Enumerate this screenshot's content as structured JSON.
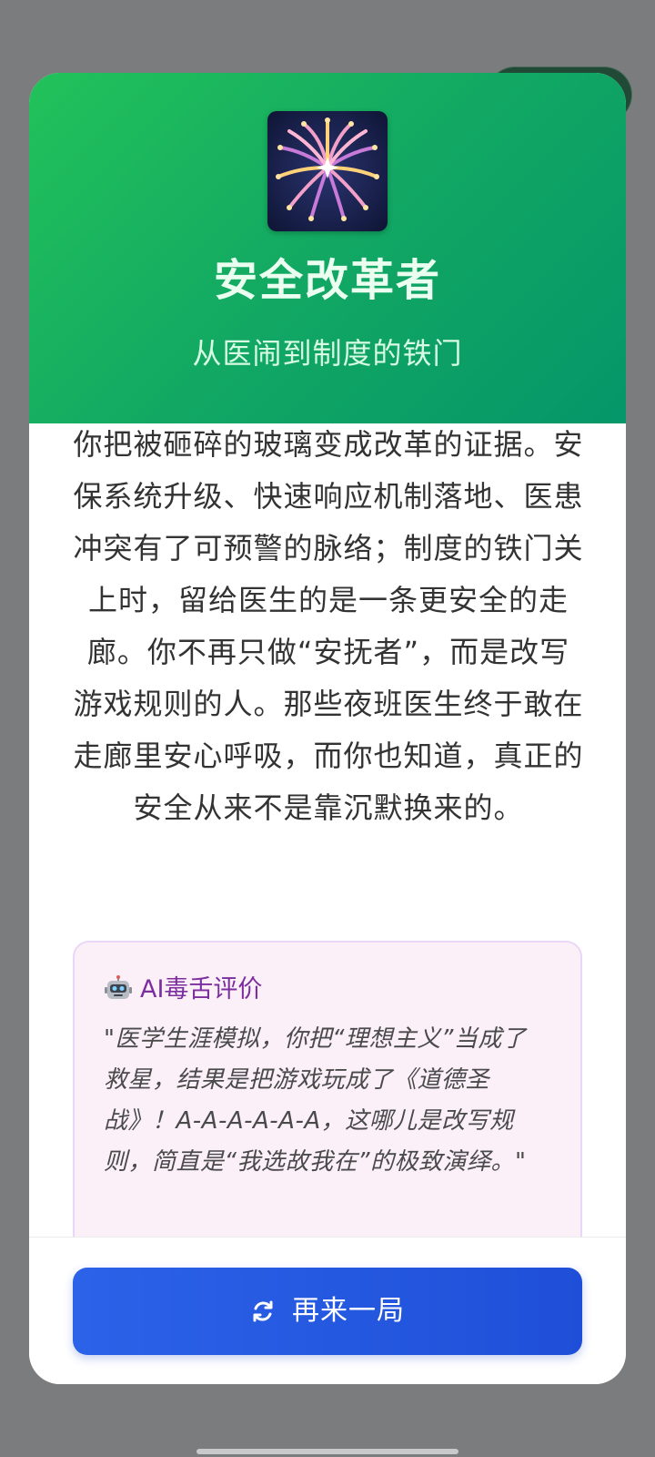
{
  "app": {
    "window_title": "安全改革者"
  },
  "capsule": {
    "more_icon": "more-dots-icon",
    "close_icon": "target-close-icon"
  },
  "result": {
    "emblem_icon": "fireworks-icon",
    "title": "安全改革者",
    "subtitle": "从医闹到制度的铁门",
    "description": "你把被砸碎的玻璃变成改革的证据。安保系统升级、快速响应机制落地、医患冲突有了可预警的脉络；制度的铁门关上时，留给医生的是一条更安全的走廊。你不再只做“安抚者”，而是改写游戏规则的人。那些夜班医生终于敢在走廊里安心呼吸，而你也知道，真正的安全从来不是靠沉默换来的。"
  },
  "ai_review": {
    "icon": "robot-icon",
    "label": "AI毒舌评价",
    "quote": "\"医学生涯模拟，你把“理想主义”当成了救星，结果是把游戏玩成了《道德圣战》！A-A-A-A-A-A，这哪儿是改写规则，简直是“我选故我在”的极致演绎。\""
  },
  "actions": {
    "replay_icon": "refresh-icon",
    "replay_label": "再来一局"
  },
  "colors": {
    "header_gradient_start": "#22c25a",
    "header_gradient_end": "#059669",
    "button_blue": "#2557e0",
    "review_accent": "#7c2d9e",
    "review_bg": "#fbf0f8"
  }
}
